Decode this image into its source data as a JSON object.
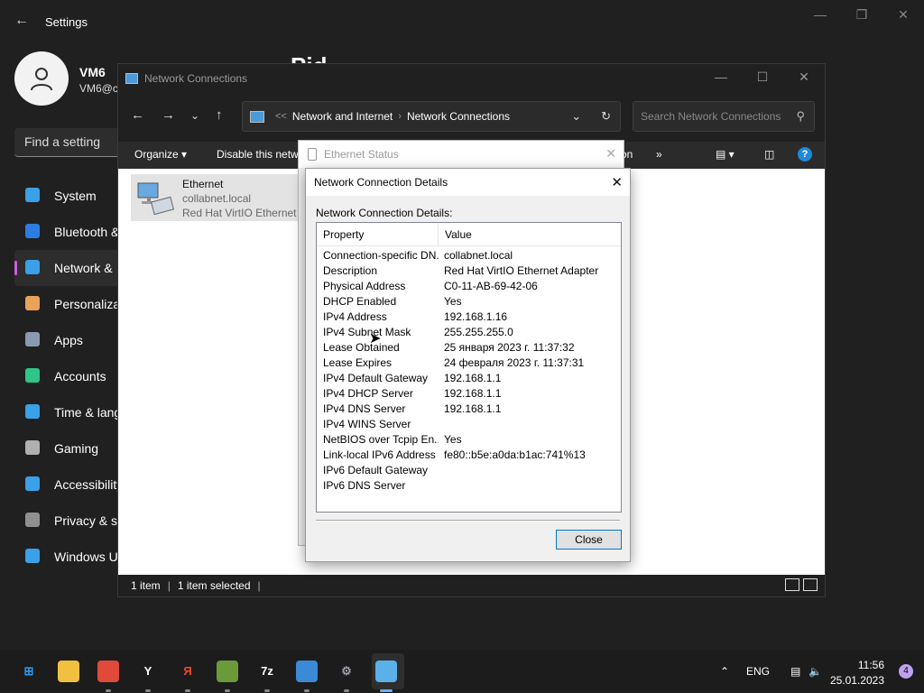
{
  "settings": {
    "title": "Settings",
    "user": {
      "name": "VM6",
      "email": "VM6@c"
    },
    "page_heading": "Pid",
    "search_placeholder": "Find a setting",
    "nav": [
      {
        "label": "System",
        "icon": "monitor-icon",
        "color": "#3aa0e8"
      },
      {
        "label": "Bluetooth &",
        "icon": "bluetooth-icon",
        "color": "#2d7de0"
      },
      {
        "label": "Network &",
        "icon": "wifi-icon",
        "color": "#3aa0e8"
      },
      {
        "label": "Personaliza",
        "icon": "brush-icon",
        "color": "#e8a25a"
      },
      {
        "label": "Apps",
        "icon": "apps-icon",
        "color": "#8a9ab0"
      },
      {
        "label": "Accounts",
        "icon": "person-icon",
        "color": "#2fc48a"
      },
      {
        "label": "Time & lang",
        "icon": "clock-globe-icon",
        "color": "#3aa0e8"
      },
      {
        "label": "Gaming",
        "icon": "gamepad-icon",
        "color": "#b0b0b0"
      },
      {
        "label": "Accessibility",
        "icon": "accessibility-icon",
        "color": "#3aa0e8"
      },
      {
        "label": "Privacy & se",
        "icon": "shield-icon",
        "color": "#909090"
      },
      {
        "label": "Windows U",
        "icon": "update-icon",
        "color": "#3aa0e8"
      }
    ],
    "active_nav_index": 2
  },
  "explorer": {
    "title": "Network Connections",
    "breadcrumb": [
      "Network and Internet",
      "Network Connections"
    ],
    "search_placeholder": "Search Network Connections",
    "toolbar": {
      "organize": "Organize",
      "disable": "Disable this netwo",
      "partial": "on",
      "more": "»"
    },
    "item": {
      "name": "Ethernet",
      "domain": "collabnet.local",
      "adapter": "Red Hat VirtIO Ethernet A"
    },
    "status": {
      "count": "1 item",
      "selected": "1 item selected"
    }
  },
  "ethernet_status": {
    "title": "Ethernet Status"
  },
  "details": {
    "title": "Network Connection Details",
    "label": "Network Connection Details:",
    "columns": {
      "property": "Property",
      "value": "Value"
    },
    "rows": [
      {
        "p": "Connection-specific DN...",
        "v": "collabnet.local"
      },
      {
        "p": "Description",
        "v": "Red Hat VirtIO Ethernet Adapter"
      },
      {
        "p": "Physical Address",
        "v": "C0-11-AB-69-42-06"
      },
      {
        "p": "DHCP Enabled",
        "v": "Yes"
      },
      {
        "p": "IPv4 Address",
        "v": "192.168.1.16"
      },
      {
        "p": "IPv4 Subnet Mask",
        "v": "255.255.255.0"
      },
      {
        "p": "Lease Obtained",
        "v": "25 января 2023 г. 11:37:32"
      },
      {
        "p": "Lease Expires",
        "v": "24 февраля 2023 г. 11:37:31"
      },
      {
        "p": "IPv4 Default Gateway",
        "v": "192.168.1.1"
      },
      {
        "p": "IPv4 DHCP Server",
        "v": "192.168.1.1"
      },
      {
        "p": "IPv4 DNS Server",
        "v": "192.168.1.1"
      },
      {
        "p": "IPv4 WINS Server",
        "v": ""
      },
      {
        "p": "NetBIOS over Tcpip En...",
        "v": "Yes"
      },
      {
        "p": "Link-local IPv6 Address",
        "v": "fe80::b5e:a0da:b1ac:741%13"
      },
      {
        "p": "IPv6 Default Gateway",
        "v": ""
      },
      {
        "p": "IPv6 DNS Server",
        "v": ""
      }
    ],
    "close_label": "Close"
  },
  "taskbar": {
    "apps": [
      {
        "name": "start-button",
        "glyph": "⊞",
        "color": "#2d9cf0"
      },
      {
        "name": "file-explorer-app",
        "glyph": "",
        "color": "#f2c041"
      },
      {
        "name": "chrome-app",
        "glyph": "",
        "color": "#e04a3a"
      },
      {
        "name": "yandex-browser-app",
        "glyph": "Y",
        "color": "#ffffff"
      },
      {
        "name": "yandex-app",
        "glyph": "Я",
        "color": "#f04a2a"
      },
      {
        "name": "minecraft-app",
        "glyph": "",
        "color": "#6a9a3a"
      },
      {
        "name": "7zip-app",
        "glyph": "7z",
        "color": "#ffffff"
      },
      {
        "name": "network-app",
        "glyph": "",
        "color": "#3a8ad8"
      },
      {
        "name": "settings-app",
        "glyph": "⚙",
        "color": "#9aa0aa"
      },
      {
        "name": "control-panel-app",
        "glyph": "",
        "color": "#5ab0e8"
      }
    ],
    "language": "ENG",
    "time": "11:56",
    "date": "25.01.2023",
    "notifications": "4"
  }
}
